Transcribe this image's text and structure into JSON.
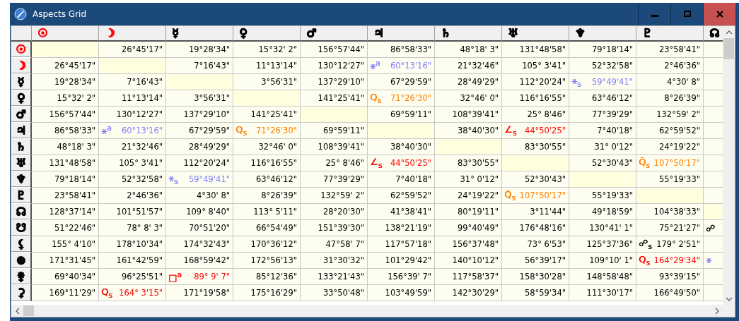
{
  "window": {
    "title": "Aspects Grid"
  },
  "columns": [
    {
      "glyph": "☉",
      "color": "#ff0000"
    },
    {
      "glyph": "☽",
      "color": "#ff0000"
    },
    {
      "glyph": "☿",
      "color": "#000000"
    },
    {
      "glyph": "♀",
      "color": "#000000"
    },
    {
      "glyph": "♂",
      "color": "#000000"
    },
    {
      "glyph": "♃",
      "color": "#000000"
    },
    {
      "glyph": "♄",
      "color": "#000000"
    },
    {
      "glyph": "♅",
      "color": "#000000"
    },
    {
      "glyph": "♆",
      "color": "#000000"
    },
    {
      "glyph": "♇",
      "color": "#000000"
    },
    {
      "glyph": "☊",
      "color": "#000000"
    }
  ],
  "rows": [
    {
      "glyph": "☉",
      "color": "#ff0000",
      "cells": [
        {
          "kind": "self"
        },
        {
          "kind": "value",
          "text": "26°45'17\""
        },
        {
          "kind": "value",
          "text": "19°28'34\""
        },
        {
          "kind": "value",
          "text": "15°32' 2\""
        },
        {
          "kind": "value",
          "text": "156°57'44\""
        },
        {
          "kind": "value",
          "text": "86°58'33\""
        },
        {
          "kind": "value",
          "text": "48°18' 3\""
        },
        {
          "kind": "value",
          "text": "131°48'58\""
        },
        {
          "kind": "value",
          "text": "79°18'14\""
        },
        {
          "kind": "value",
          "text": "23°58'41\""
        },
        {
          "kind": "empty"
        }
      ]
    },
    {
      "glyph": "☽",
      "color": "#ff0000",
      "cells": [
        {
          "kind": "value",
          "text": "26°45'17\""
        },
        {
          "kind": "self"
        },
        {
          "kind": "value",
          "text": "7°16'43\""
        },
        {
          "kind": "value",
          "text": "11°13'14\""
        },
        {
          "kind": "value",
          "text": "130°12'27\""
        },
        {
          "kind": "aspect",
          "symbol": "⚹$^{a}$",
          "text": "60°13'16\"",
          "color": "#8080ff"
        },
        {
          "kind": "value",
          "text": "21°32'46\""
        },
        {
          "kind": "value",
          "text": "105° 3'41\""
        },
        {
          "kind": "value",
          "text": "52°32'58\""
        },
        {
          "kind": "value",
          "text": "2°46'36\""
        },
        {
          "kind": "empty"
        }
      ]
    },
    {
      "glyph": "☿",
      "color": "#000000",
      "cells": [
        {
          "kind": "value",
          "text": "19°28'34\""
        },
        {
          "kind": "value",
          "text": "7°16'43\""
        },
        {
          "kind": "self"
        },
        {
          "kind": "value",
          "text": "3°56'31\""
        },
        {
          "kind": "value",
          "text": "137°29'10\""
        },
        {
          "kind": "value",
          "text": "67°29'59\""
        },
        {
          "kind": "value",
          "text": "28°49'29\""
        },
        {
          "kind": "value",
          "text": "112°20'24\""
        },
        {
          "kind": "aspect",
          "symbol": "⚹$_{s}$",
          "text": "59°49'41\"",
          "color": "#8080ff"
        },
        {
          "kind": "value",
          "text": "4°30' 8\""
        },
        {
          "kind": "empty"
        }
      ]
    },
    {
      "glyph": "♀",
      "color": "#000000",
      "cells": [
        {
          "kind": "value",
          "text": "15°32' 2\""
        },
        {
          "kind": "value",
          "text": "11°13'14\""
        },
        {
          "kind": "value",
          "text": "3°56'31\""
        },
        {
          "kind": "self"
        },
        {
          "kind": "value",
          "text": "141°25'41\""
        },
        {
          "kind": "aspect",
          "symbol": "Q$_{s}$",
          "text": "71°26'30\"",
          "color": "#ff8000"
        },
        {
          "kind": "value",
          "text": "32°46' 0\""
        },
        {
          "kind": "value",
          "text": "116°16'55\""
        },
        {
          "kind": "value",
          "text": "63°46'12\""
        },
        {
          "kind": "value",
          "text": "8°26'39\""
        },
        {
          "kind": "empty"
        }
      ]
    },
    {
      "glyph": "♂",
      "color": "#000000",
      "cells": [
        {
          "kind": "value",
          "text": "156°57'44\""
        },
        {
          "kind": "value",
          "text": "130°12'27\""
        },
        {
          "kind": "value",
          "text": "137°29'10\""
        },
        {
          "kind": "value",
          "text": "141°25'41\""
        },
        {
          "kind": "self"
        },
        {
          "kind": "value",
          "text": "69°59'11\""
        },
        {
          "kind": "value",
          "text": "108°39'41\""
        },
        {
          "kind": "value",
          "text": "25° 8'46\""
        },
        {
          "kind": "value",
          "text": "77°39'29\""
        },
        {
          "kind": "value",
          "text": "132°59' 2\""
        },
        {
          "kind": "empty"
        }
      ]
    },
    {
      "glyph": "♃",
      "color": "#000000",
      "cells": [
        {
          "kind": "value",
          "text": "86°58'33\""
        },
        {
          "kind": "aspect",
          "symbol": "⚹$^{a}$",
          "text": "60°13'16\"",
          "color": "#8080ff"
        },
        {
          "kind": "value",
          "text": "67°29'59\""
        },
        {
          "kind": "aspect",
          "symbol": "Q$_{s}$",
          "text": "71°26'30\"",
          "color": "#ff8000"
        },
        {
          "kind": "value",
          "text": "69°59'11\""
        },
        {
          "kind": "self"
        },
        {
          "kind": "value",
          "text": "38°40'30\""
        },
        {
          "kind": "aspect",
          "symbol": "∠$_{s}$",
          "text": "44°50'25\"",
          "color": "#ff0000"
        },
        {
          "kind": "value",
          "text": "7°40'18\""
        },
        {
          "kind": "value",
          "text": "62°59'52\""
        },
        {
          "kind": "empty"
        }
      ]
    },
    {
      "glyph": "♄",
      "color": "#000000",
      "cells": [
        {
          "kind": "value",
          "text": "48°18' 3\""
        },
        {
          "kind": "value",
          "text": "21°32'46\""
        },
        {
          "kind": "value",
          "text": "28°49'29\""
        },
        {
          "kind": "value",
          "text": "32°46' 0\""
        },
        {
          "kind": "value",
          "text": "108°39'41\""
        },
        {
          "kind": "value",
          "text": "38°40'30\""
        },
        {
          "kind": "self"
        },
        {
          "kind": "value",
          "text": "83°30'55\""
        },
        {
          "kind": "value",
          "text": "31° 0'12\""
        },
        {
          "kind": "value",
          "text": "24°19'22\""
        },
        {
          "kind": "empty"
        }
      ]
    },
    {
      "glyph": "♅",
      "color": "#000000",
      "cells": [
        {
          "kind": "value",
          "text": "131°48'58\""
        },
        {
          "kind": "value",
          "text": "105° 3'41\""
        },
        {
          "kind": "value",
          "text": "112°20'24\""
        },
        {
          "kind": "value",
          "text": "116°16'55\""
        },
        {
          "kind": "value",
          "text": "25° 8'46\""
        },
        {
          "kind": "aspect",
          "symbol": "∠$_{s}$",
          "text": "44°50'25\"",
          "color": "#ff0000"
        },
        {
          "kind": "value",
          "text": "83°30'55\""
        },
        {
          "kind": "self"
        },
        {
          "kind": "value",
          "text": "52°30'43\""
        },
        {
          "kind": "aspect",
          "symbol": "Q̃$_{s}$",
          "text": "107°50'17\"",
          "color": "#ff8000"
        },
        {
          "kind": "empty"
        }
      ]
    },
    {
      "glyph": "♆",
      "color": "#000000",
      "cells": [
        {
          "kind": "value",
          "text": "79°18'14\""
        },
        {
          "kind": "value",
          "text": "52°32'58\""
        },
        {
          "kind": "aspect",
          "symbol": "⚹$_{s}$",
          "text": "59°49'41\"",
          "color": "#8080ff"
        },
        {
          "kind": "value",
          "text": "63°46'12\""
        },
        {
          "kind": "value",
          "text": "77°39'29\""
        },
        {
          "kind": "value",
          "text": "7°40'18\""
        },
        {
          "kind": "value",
          "text": "31° 0'12\""
        },
        {
          "kind": "value",
          "text": "52°30'43\""
        },
        {
          "kind": "self"
        },
        {
          "kind": "value",
          "text": "55°19'33\""
        },
        {
          "kind": "empty"
        }
      ]
    },
    {
      "glyph": "♇",
      "color": "#000000",
      "cells": [
        {
          "kind": "value",
          "text": "23°58'41\""
        },
        {
          "kind": "value",
          "text": "2°46'36\""
        },
        {
          "kind": "value",
          "text": "4°30' 8\""
        },
        {
          "kind": "value",
          "text": "8°26'39\""
        },
        {
          "kind": "value",
          "text": "132°59' 2\""
        },
        {
          "kind": "value",
          "text": "62°59'52\""
        },
        {
          "kind": "value",
          "text": "24°19'22\""
        },
        {
          "kind": "aspect",
          "symbol": "Q̃$_{s}$",
          "text": "107°50'17\"",
          "color": "#ff8000"
        },
        {
          "kind": "value",
          "text": "55°19'33\""
        },
        {
          "kind": "self"
        },
        {
          "kind": "empty"
        }
      ]
    },
    {
      "glyph": "☊",
      "color": "#000000",
      "cells": [
        {
          "kind": "value",
          "text": "128°37'14\""
        },
        {
          "kind": "value",
          "text": "101°51'57\""
        },
        {
          "kind": "value",
          "text": "109° 8'40\""
        },
        {
          "kind": "value",
          "text": "113° 5'11\""
        },
        {
          "kind": "value",
          "text": "28°20'30\""
        },
        {
          "kind": "value",
          "text": "41°38'41\""
        },
        {
          "kind": "value",
          "text": "80°19'11\""
        },
        {
          "kind": "value",
          "text": "3°11'44\""
        },
        {
          "kind": "value",
          "text": "49°18'59\""
        },
        {
          "kind": "value",
          "text": "104°38'33\""
        },
        {
          "kind": "self"
        }
      ]
    },
    {
      "glyph": "☋",
      "color": "#000000",
      "cells": [
        {
          "kind": "value",
          "text": "51°22'46\""
        },
        {
          "kind": "value",
          "text": "78° 8' 3\""
        },
        {
          "kind": "value",
          "text": "70°51'20\""
        },
        {
          "kind": "value",
          "text": "66°54'49\""
        },
        {
          "kind": "value",
          "text": "151°39'30\""
        },
        {
          "kind": "value",
          "text": "138°21'19\""
        },
        {
          "kind": "value",
          "text": "99°40'49\""
        },
        {
          "kind": "value",
          "text": "176°48'16\""
        },
        {
          "kind": "value",
          "text": "130°41' 1\""
        },
        {
          "kind": "value",
          "text": "75°21'27\""
        },
        {
          "kind": "aspect",
          "symbol": "☍",
          "color": "#000000"
        }
      ]
    },
    {
      "glyph": "⚸",
      "color": "#000000",
      "cells": [
        {
          "kind": "value",
          "text": "155° 4'10\""
        },
        {
          "kind": "value",
          "text": "178°10'34\""
        },
        {
          "kind": "value",
          "text": "174°32'43\""
        },
        {
          "kind": "value",
          "text": "170°36'12\""
        },
        {
          "kind": "value",
          "text": "47°58' 7\""
        },
        {
          "kind": "value",
          "text": "117°57'18\""
        },
        {
          "kind": "value",
          "text": "156°37'48\""
        },
        {
          "kind": "value",
          "text": "73° 6'53\""
        },
        {
          "kind": "value",
          "text": "125°37'36\""
        },
        {
          "kind": "aspect",
          "symbol": "☍$_{s}$",
          "text": "179° 2'51\"",
          "color": "#000000"
        },
        {
          "kind": "empty"
        }
      ]
    },
    {
      "glyph": "⊕",
      "color": "#000000",
      "cells": [
        {
          "kind": "value",
          "text": "171°31'45\""
        },
        {
          "kind": "value",
          "text": "161°42'59\""
        },
        {
          "kind": "value",
          "text": "168°59'42\""
        },
        {
          "kind": "value",
          "text": "172°56'13\""
        },
        {
          "kind": "value",
          "text": "31°30'32\""
        },
        {
          "kind": "value",
          "text": "101°29'42\""
        },
        {
          "kind": "value",
          "text": "140°10'12\""
        },
        {
          "kind": "value",
          "text": "56°39'17\""
        },
        {
          "kind": "value",
          "text": "109°10' 1\""
        },
        {
          "kind": "aspect",
          "symbol": "Q$_{s}$",
          "text": "164°29'34\"",
          "color": "#ff0000"
        },
        {
          "kind": "aspect",
          "symbol": "⚹",
          "color": "#8080ff"
        }
      ]
    },
    {
      "glyph": "⚵",
      "color": "#000000",
      "cells": [
        {
          "kind": "value",
          "text": "69°40'34\""
        },
        {
          "kind": "value",
          "text": "96°25'51\""
        },
        {
          "kind": "aspect",
          "symbol": "□$^{a}$",
          "text": "89° 9' 7\"",
          "color": "#ff0000"
        },
        {
          "kind": "value",
          "text": "85°12'36\""
        },
        {
          "kind": "value",
          "text": "133°21'43\""
        },
        {
          "kind": "value",
          "text": "156°39' 7\""
        },
        {
          "kind": "value",
          "text": "117°58'37\""
        },
        {
          "kind": "value",
          "text": "158°30'28\""
        },
        {
          "kind": "value",
          "text": "148°58'48\""
        },
        {
          "kind": "value",
          "text": "93°39'15\""
        },
        {
          "kind": "empty"
        }
      ]
    },
    {
      "glyph": "⚳",
      "color": "#000000",
      "cells": [
        {
          "kind": "value",
          "text": "169°11'29\""
        },
        {
          "kind": "aspect",
          "symbol": "Q$_{s}$",
          "text": "164° 3'15\"",
          "color": "#ff0000"
        },
        {
          "kind": "value",
          "text": "171°19'58\""
        },
        {
          "kind": "value",
          "text": "175°16'29\""
        },
        {
          "kind": "value",
          "text": "33°50'48\""
        },
        {
          "kind": "value",
          "text": "103°49'59\""
        },
        {
          "kind": "value",
          "text": "142°30'29\""
        },
        {
          "kind": "value",
          "text": "58°59'34\""
        },
        {
          "kind": "value",
          "text": "111°30'17\""
        },
        {
          "kind": "value",
          "text": "166°49'50\""
        },
        {
          "kind": "empty"
        }
      ]
    }
  ]
}
